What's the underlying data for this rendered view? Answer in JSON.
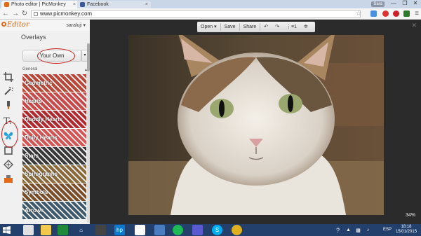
{
  "browser": {
    "tabs": [
      {
        "title": "Photo editor | PicMonkey",
        "close": "×"
      },
      {
        "title": "Facebook",
        "close": "×"
      }
    ],
    "user": "Sara",
    "address": "www.picmonkey.com",
    "window_controls": [
      "—",
      "❐",
      "✕"
    ]
  },
  "editor": {
    "brand": "Editor",
    "username": "saraluji",
    "username_arrow": "▾"
  },
  "panel": {
    "title": "Overlays",
    "your_own_label": "Your Own",
    "dropdown_arrow": "▾",
    "group_label": "General",
    "group_arrow": "▴",
    "categories": [
      {
        "label": "Geometric",
        "color": "#b8493a"
      },
      {
        "label": "Hearts",
        "color": "#c94a4a"
      },
      {
        "label": "Doodly Hearts",
        "color": "#b02a30"
      },
      {
        "label": "Doily Hearts",
        "color": "#d55454"
      },
      {
        "label": "Stars",
        "color": "#3a3a3a"
      },
      {
        "label": "Spirographs",
        "color": "#8a6a3a"
      },
      {
        "label": "Symbols",
        "color": "#7a4e2a"
      },
      {
        "label": "Arrows",
        "color": "#3e5a6a"
      }
    ]
  },
  "toolbar": {
    "open_label": "Open",
    "open_arrow": "▾",
    "save_label": "Save",
    "share_label": "Share",
    "undo": "↶",
    "redo": "↷",
    "history": "⋮≡1",
    "settings": "✲"
  },
  "canvas": {
    "close": "✕",
    "zoom": "34%"
  },
  "taskbar": {
    "lang": "ESP",
    "time": "18:18",
    "date": "15/01/2015"
  },
  "colors": {
    "accent": "#e26a1a",
    "annotation": "#c81c1c",
    "canvas_bg": "#2b2b2b",
    "taskbar_bg": "#233f6b"
  }
}
